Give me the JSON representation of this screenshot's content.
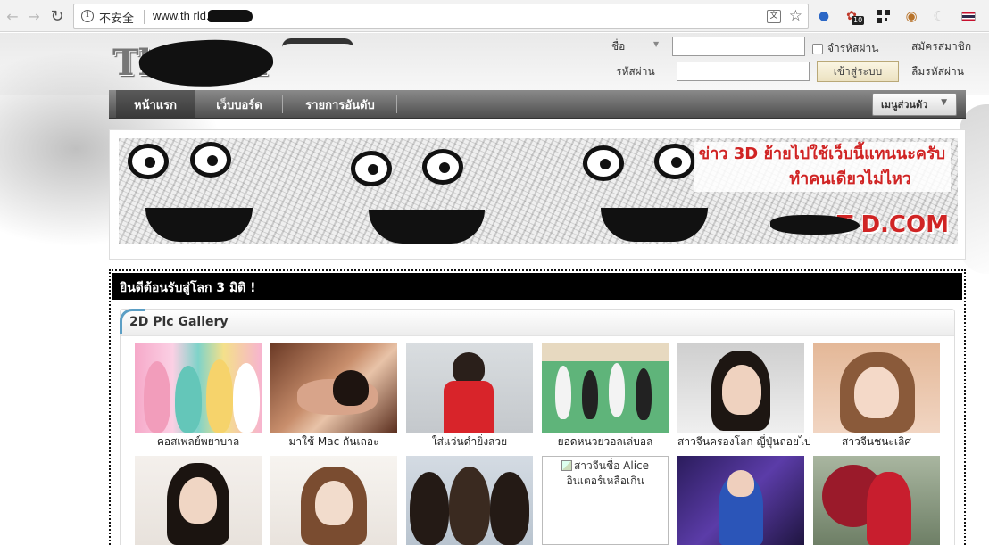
{
  "browser": {
    "security_label": "不安全",
    "url": "www.th      rld.com",
    "translate_icon": "translate-icon",
    "extension_badge_count": "10"
  },
  "site": {
    "logo_text": "Th          .com"
  },
  "login": {
    "username_label": "ชื่อ",
    "password_label": "รหัสผ่าน",
    "username_value": "",
    "password_value": "",
    "remember_label": "จำรหัสผ่าน",
    "login_button": "เข้าสู่ระบบ",
    "register_link": "สมัครสมาชิก",
    "forgot_link": "ลืมรหัสผ่าน"
  },
  "nav": {
    "items": [
      {
        "label": "หน้าแรก"
      },
      {
        "label": "เว็บบอร์ด"
      },
      {
        "label": "รายการอันดับ"
      }
    ],
    "menu_button": "เมนูส่วนตัว"
  },
  "banner": {
    "headline_1": "ข่าว 3D ย้ายไปใช้เว็บนี้แทนนะครับ",
    "headline_2": "ทำคนเดียวไม่ไหว",
    "brand": "T        D.COM"
  },
  "content": {
    "welcome": "ยินดีต้อนรับสู่โลก 3 มิติ !",
    "gallery_title": "2D Pic Gallery",
    "row1": [
      {
        "caption": "คอสเพลย์พยาบาล"
      },
      {
        "caption": "มาใช้ Mac กันเถอะ"
      },
      {
        "caption": "ใส่แว่นดำยิ่งสวย"
      },
      {
        "caption": "ยอดหนวยวอลเล่บอล"
      },
      {
        "caption": "สาวจีนครองโลก ญี่ปุ่นถอยไป"
      },
      {
        "caption": "สาวจีนชนะเลิศ"
      }
    ],
    "broken_image_alt": "สาวจีนชื่อ Alice อินเตอร์เหลือเกิน"
  },
  "colors": {
    "nav_dark": "#4e4e4e",
    "headline_red": "#d02424",
    "welcome_bg": "#000000",
    "gallery_accent": "#5c9fc5"
  }
}
